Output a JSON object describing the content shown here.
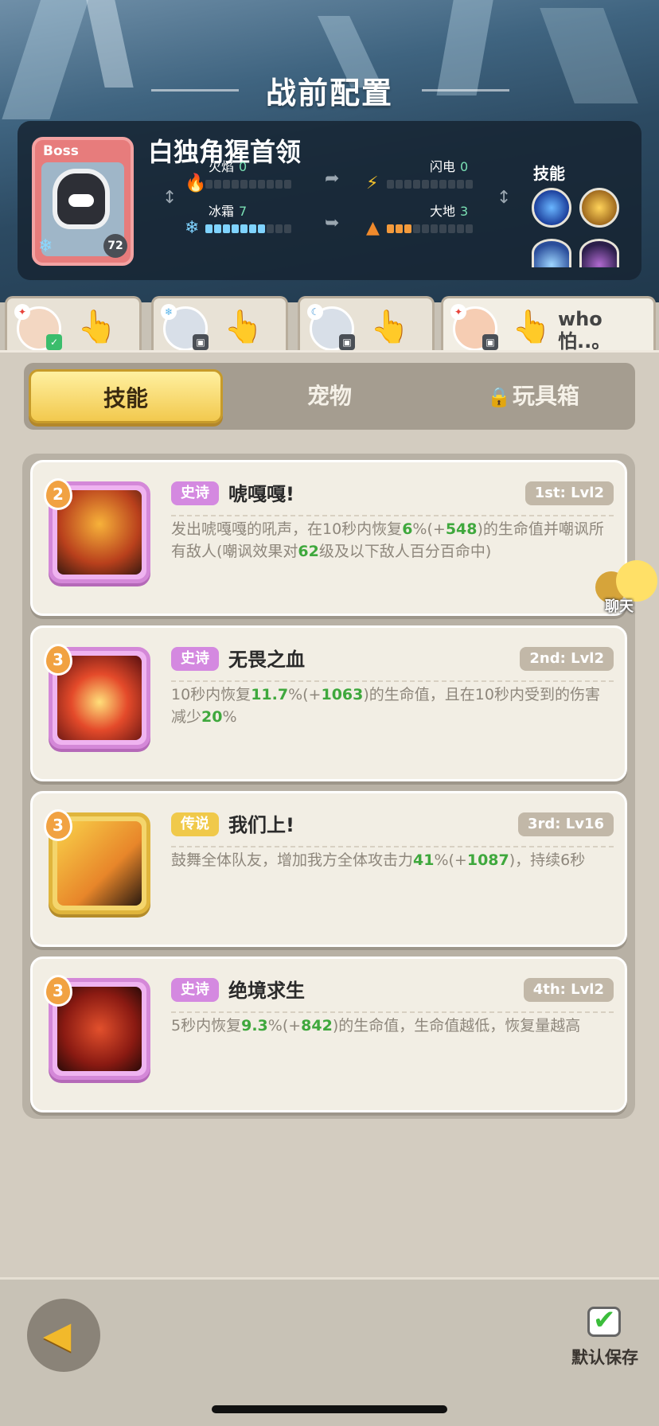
{
  "page_title": "战前配置",
  "boss": {
    "tag": "Boss",
    "name": "白独角猩首领",
    "level": "72",
    "stats": {
      "fire": {
        "label": "火焰",
        "value": "0",
        "level": 0
      },
      "lightning": {
        "label": "闪电",
        "value": "0",
        "level": 0
      },
      "frost": {
        "label": "冰霜",
        "value": "7",
        "level": 7
      },
      "earth": {
        "label": "大地",
        "value": "3",
        "level": 3
      }
    },
    "skills_label": "技能",
    "skill_icons": [
      "blue-star-orb-icon",
      "gold-burst-orb-icon",
      "frost-orb-icon",
      "dark-orb-icon"
    ]
  },
  "heroes": [
    {
      "name": "hero-1",
      "active": false,
      "element": "fire-icon"
    },
    {
      "name": "hero-2",
      "active": false,
      "element": "frost-icon"
    },
    {
      "name": "hero-3",
      "active": false,
      "element": "lightning-icon"
    },
    {
      "name": "hero-4",
      "active": true,
      "player_name": "who怕..。",
      "element": "fire-icon"
    }
  ],
  "tabs": {
    "skills": "技能",
    "pets": "宠物",
    "toybox": "玩具箱"
  },
  "skills": [
    {
      "level": "2",
      "rarity": "史诗",
      "name": "唬嘎嘎!",
      "slot": "1st: Lvl2",
      "desc_parts": [
        {
          "t": "发出唬嘎嘎的吼声，在10秒内恢复"
        },
        {
          "t": "6",
          "hl": true
        },
        {
          "t": "%(+"
        },
        {
          "t": "548",
          "hl": true
        },
        {
          "t": ")的生命值并嘲讽所有敌人(嘲讽效果对"
        },
        {
          "t": "62",
          "hl": true
        },
        {
          "t": "级及以下敌人百分百命中)"
        }
      ]
    },
    {
      "level": "3",
      "rarity": "史诗",
      "name": "无畏之血",
      "slot": "2nd: Lvl2",
      "desc_parts": [
        {
          "t": "10秒内恢复"
        },
        {
          "t": "11.7",
          "hl": true
        },
        {
          "t": "%(+"
        },
        {
          "t": "1063",
          "hl": true
        },
        {
          "t": ")的生命值，且在10秒内受到的伤害减少"
        },
        {
          "t": "20",
          "hl": true
        },
        {
          "t": "%"
        }
      ]
    },
    {
      "level": "3",
      "rarity": "传说",
      "name": "我们上!",
      "slot": "3rd: Lv16",
      "desc_parts": [
        {
          "t": "鼓舞全体队友，增加我方全体攻击力"
        },
        {
          "t": "41",
          "hl": true
        },
        {
          "t": "%(+"
        },
        {
          "t": "1087",
          "hl": true
        },
        {
          "t": ")，持续6秒"
        }
      ]
    },
    {
      "level": "3",
      "rarity": "史诗",
      "name": "绝境求生",
      "slot": "4th: Lvl2",
      "desc_parts": [
        {
          "t": "5秒内恢复"
        },
        {
          "t": "9.3",
          "hl": true
        },
        {
          "t": "%(+"
        },
        {
          "t": "842",
          "hl": true
        },
        {
          "t": ")的生命值，生命值越低，恢复量越高"
        }
      ]
    }
  ],
  "chat_label": "聊天",
  "save_label": "默认保存",
  "colors": {
    "highlight": "#3fa83d",
    "epic": "#d489e0",
    "legend": "#f0c94a",
    "gold_button": "#f2c94e"
  }
}
